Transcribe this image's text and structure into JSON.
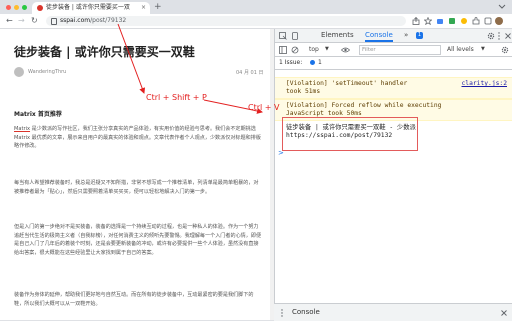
{
  "browser": {
    "tab_title": "徒步装备 | 或许你只需要买一双",
    "tab_close": "×",
    "new_tab": "+",
    "url_host": "sspai.com",
    "url_path": "/post/79132",
    "back": "←",
    "forward": "→",
    "reload": "↻"
  },
  "page": {
    "title": "徒步装备 | 或许你只需要买一双鞋",
    "author": "WanderingThru",
    "date": "04 月 01 日",
    "section_heading": "Matrix 首页推荐",
    "para1_hl": "Matrix",
    "para1": " 是少数派的写作社区，我们主张分享真实的产品体验，有实用价值的经验与思考。我们会不定期挑选 Matrix 最优质的文章，展示来自用户的最真实的体验和观点。文章代表作者个人观点，少数派仅对标题和排版略作修改。",
    "para2": "每当有人希望推荐装备时，我总是迟疑又不知所措，非常不想写成一个推荐清单，列清单是最简单粗暴的，对被推荐者最为「贴心」，然后只需要照着清单买买买，便可以轻松地解决入门的第一步。",
    "para3": "但是入门的第一步绝对不是买装备，装备的选择是一个持续互动的过程，也是一种私人的体验。作为一个努力追赶当代生活的极简主义者（自我标榜），对任何消费主义的倾听先要警惕。我理解每一个入门者的心情，即便是自己入门了几年后的着装个时刻，还是会要更新装备的冲动，或许有必要提供一些个人体验，虽然没有直接给出答案，很大概能在这些经验里让大家找到属于自己的答案。",
    "para4": "装备作为身体的延伸，帮助我们更好地与自然互动。而在所有的徒步装备中，互动最紧密的要是我们脚下的鞋，所以我们大概可以从一双鞋开始。"
  },
  "devtools": {
    "tabs": [
      "Elements",
      "Console",
      "»"
    ],
    "active_tab": "Console",
    "badge_count": "1",
    "context": "top",
    "filter_placeholder": "Filter",
    "levels": "All levels",
    "issues_text": "1 Issue:",
    "issues_count": "1",
    "violation1_line1": "[Violation] 'setTimeout' handler",
    "violation1_line2": "took 51ms",
    "violation1_source": "clarity.js:2",
    "violation2_line1": "[Violation] Forced reflow while executing",
    "violation2_line2": "JavaScript took 50ms",
    "log_line1": "徒步装备 | 或许你只需要买一双鞋 - 少数派",
    "log_line2": "https://sspai.com/post/79132",
    "prompt": ">",
    "drawer_tab": "Console"
  },
  "annotations": {
    "copy_shortcut": "Ctrl + Shift + P",
    "paste_shortcut": "Ctrl + V"
  },
  "colors": {
    "accent": "#1a73e8",
    "annotation": "#e32020",
    "favicon": "#d9342b"
  }
}
